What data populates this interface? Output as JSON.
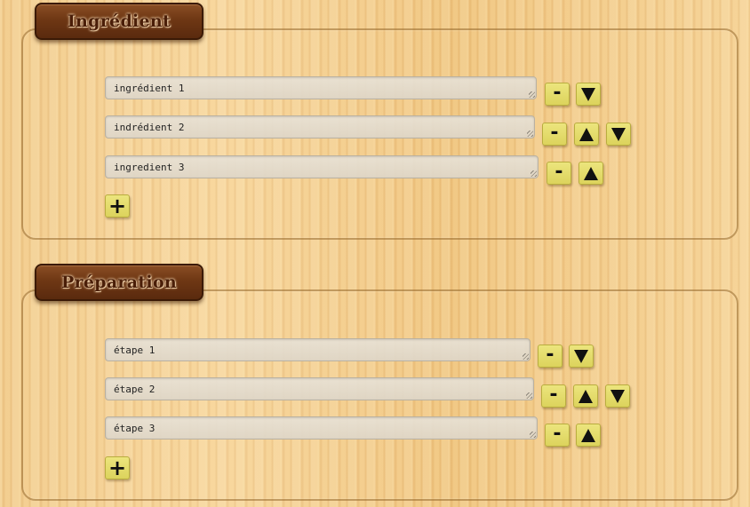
{
  "ingredients": {
    "title": "Ingrédient",
    "items": [
      {
        "value": "ingrédient 1"
      },
      {
        "value": "indrédient 2"
      },
      {
        "value": "ingredient 3"
      }
    ]
  },
  "preparation": {
    "title": "Préparation",
    "items": [
      {
        "value": "étape 1"
      },
      {
        "value": "étape 2"
      },
      {
        "value": "étape 3"
      }
    ]
  },
  "buttons": {
    "remove": "-",
    "add": "+"
  },
  "icons": {
    "move_up": "triangle-up-icon",
    "move_down": "triangle-down-icon",
    "resize": "resize-grip-icon"
  }
}
